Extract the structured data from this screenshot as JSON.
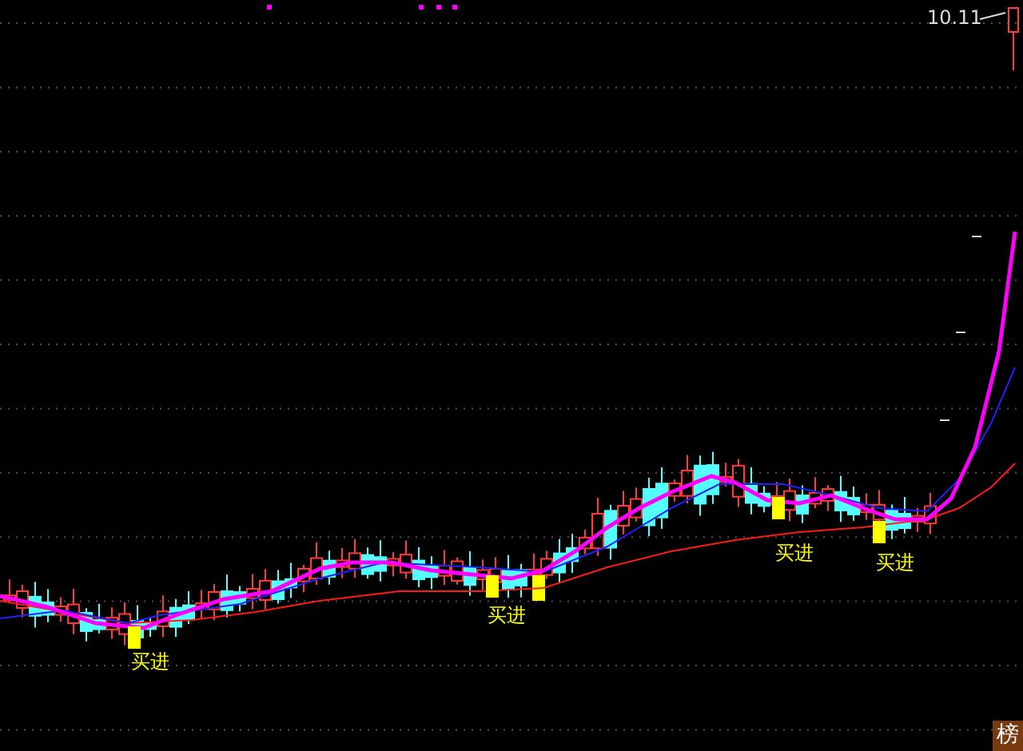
{
  "price_label": "10.11",
  "buy_signals": [
    {
      "label": "买进"
    },
    {
      "label": "买进"
    },
    {
      "label": "买进"
    },
    {
      "label": "买进"
    }
  ],
  "badge": "榜"
}
